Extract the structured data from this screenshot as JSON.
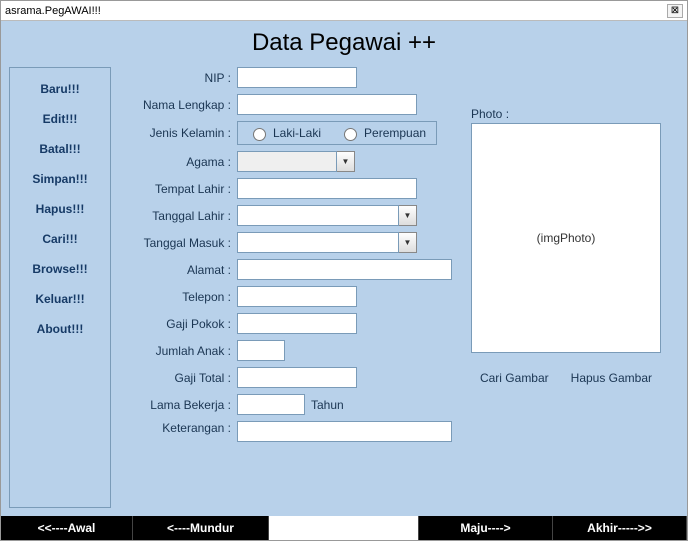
{
  "window": {
    "title": "asrama.PegAWAI!!!",
    "close_glyph": "⊠"
  },
  "page_title": "Data Pegawai ++",
  "sidebar": {
    "items": [
      {
        "label": "Baru!!!"
      },
      {
        "label": "Edit!!!"
      },
      {
        "label": "Batal!!!"
      },
      {
        "label": "Simpan!!!"
      },
      {
        "label": "Hapus!!!"
      },
      {
        "label": "Cari!!!"
      },
      {
        "label": "Browse!!!"
      },
      {
        "label": "Keluar!!!"
      },
      {
        "label": "About!!!"
      }
    ]
  },
  "form": {
    "nip": {
      "label": "NIP :",
      "value": ""
    },
    "nama": {
      "label": "Nama Lengkap :",
      "value": ""
    },
    "jk": {
      "label": "Jenis Kelamin :",
      "opt1": "Laki-Laki",
      "opt2": "Perempuan"
    },
    "agama": {
      "label": "Agama :",
      "value": ""
    },
    "tempat": {
      "label": "Tempat Lahir :",
      "value": ""
    },
    "tgl_lahir": {
      "label": "Tanggal Lahir :",
      "value": ""
    },
    "tgl_masuk": {
      "label": "Tanggal Masuk :",
      "value": ""
    },
    "alamat": {
      "label": "Alamat :",
      "value": ""
    },
    "telepon": {
      "label": "Telepon :",
      "value": ""
    },
    "gaji_pokok": {
      "label": "Gaji Pokok :",
      "value": ""
    },
    "jumlah_anak": {
      "label": "Jumlah Anak :",
      "value": ""
    },
    "gaji_total": {
      "label": "Gaji Total :",
      "value": ""
    },
    "lama": {
      "label": "Lama Bekerja :",
      "value": "",
      "suffix": "Tahun"
    },
    "ket": {
      "label": "Keterangan :",
      "value": ""
    }
  },
  "photo": {
    "label": "Photo :",
    "placeholder": "(imgPhoto)",
    "btn_search": "Cari Gambar",
    "btn_delete": "Hapus Gambar"
  },
  "footer": {
    "first": "<<----Awal",
    "prev": "<----Mundur",
    "current": "",
    "next": "Maju---->",
    "last": "Akhir----->>"
  }
}
